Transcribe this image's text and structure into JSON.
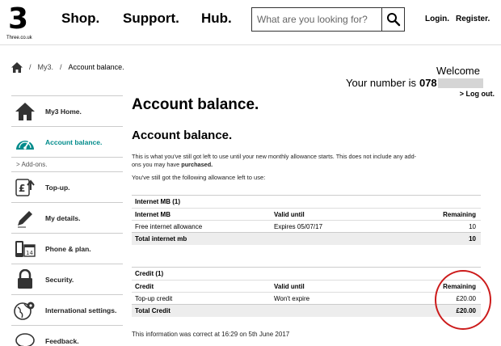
{
  "brand": {
    "logo_text": "3",
    "logo_sub": "Three.co.uk"
  },
  "nav": {
    "shop": "Shop.",
    "support": "Support.",
    "hub": "Hub."
  },
  "search": {
    "placeholder": "What are you looking for?"
  },
  "top_links": {
    "login": "Login.",
    "register": "Register."
  },
  "breadcrumb": {
    "home_icon": "home-icon",
    "sep": "/",
    "item1": "My3.",
    "item2": "Account balance."
  },
  "welcome": {
    "title": "Welcome",
    "number_label": "Your number is",
    "number_prefix": "078",
    "logout": "> Log out."
  },
  "sidebar": {
    "items": [
      {
        "label": "My3 Home.",
        "icon": "house-icon"
      },
      {
        "label": "Account balance.",
        "icon": "gauge-icon",
        "active": true
      },
      {
        "label": "Top-up.",
        "icon": "pound-topup-icon"
      },
      {
        "label": "My details.",
        "icon": "pencil-icon"
      },
      {
        "label": "Phone & plan.",
        "icon": "calendar-phone-icon"
      },
      {
        "label": "Security.",
        "icon": "padlock-icon"
      },
      {
        "label": "International settings.",
        "icon": "globe-gear-icon"
      },
      {
        "label": "Feedback.",
        "icon": "speech-bubble-icon"
      }
    ],
    "sub_item": "> Add-ons."
  },
  "main": {
    "title": "Account balance.",
    "section_title": "Account balance.",
    "intro_part1": "This is what you've still got left to use until your new monthly allowance starts. This does not include any add-ons you may have",
    "intro_bold": "purchased.",
    "intro2": "You've still got the following allowance left to use:",
    "internet": {
      "caption": "Internet MB (1)",
      "headers": [
        "Internet MB",
        "Valid until",
        "Remaining"
      ],
      "rows": [
        [
          "Free internet allowance",
          "Expires 05/07/17",
          "10"
        ]
      ],
      "total": [
        "Total internet mb",
        "",
        "10"
      ]
    },
    "credit": {
      "caption": "Credit (1)",
      "headers": [
        "Credit",
        "Valid until",
        "Remaining"
      ],
      "rows": [
        [
          "Top-up credit",
          "Won't expire",
          "£20.00"
        ]
      ],
      "total": [
        "Total Credit",
        "",
        "£20.00"
      ]
    },
    "footnote": "This information was correct at 16:29 on 5th June 2017"
  },
  "colors": {
    "accent": "#008b8b",
    "annotation_circle": "#cc1b1b",
    "total_row_bg": "#ededed"
  }
}
